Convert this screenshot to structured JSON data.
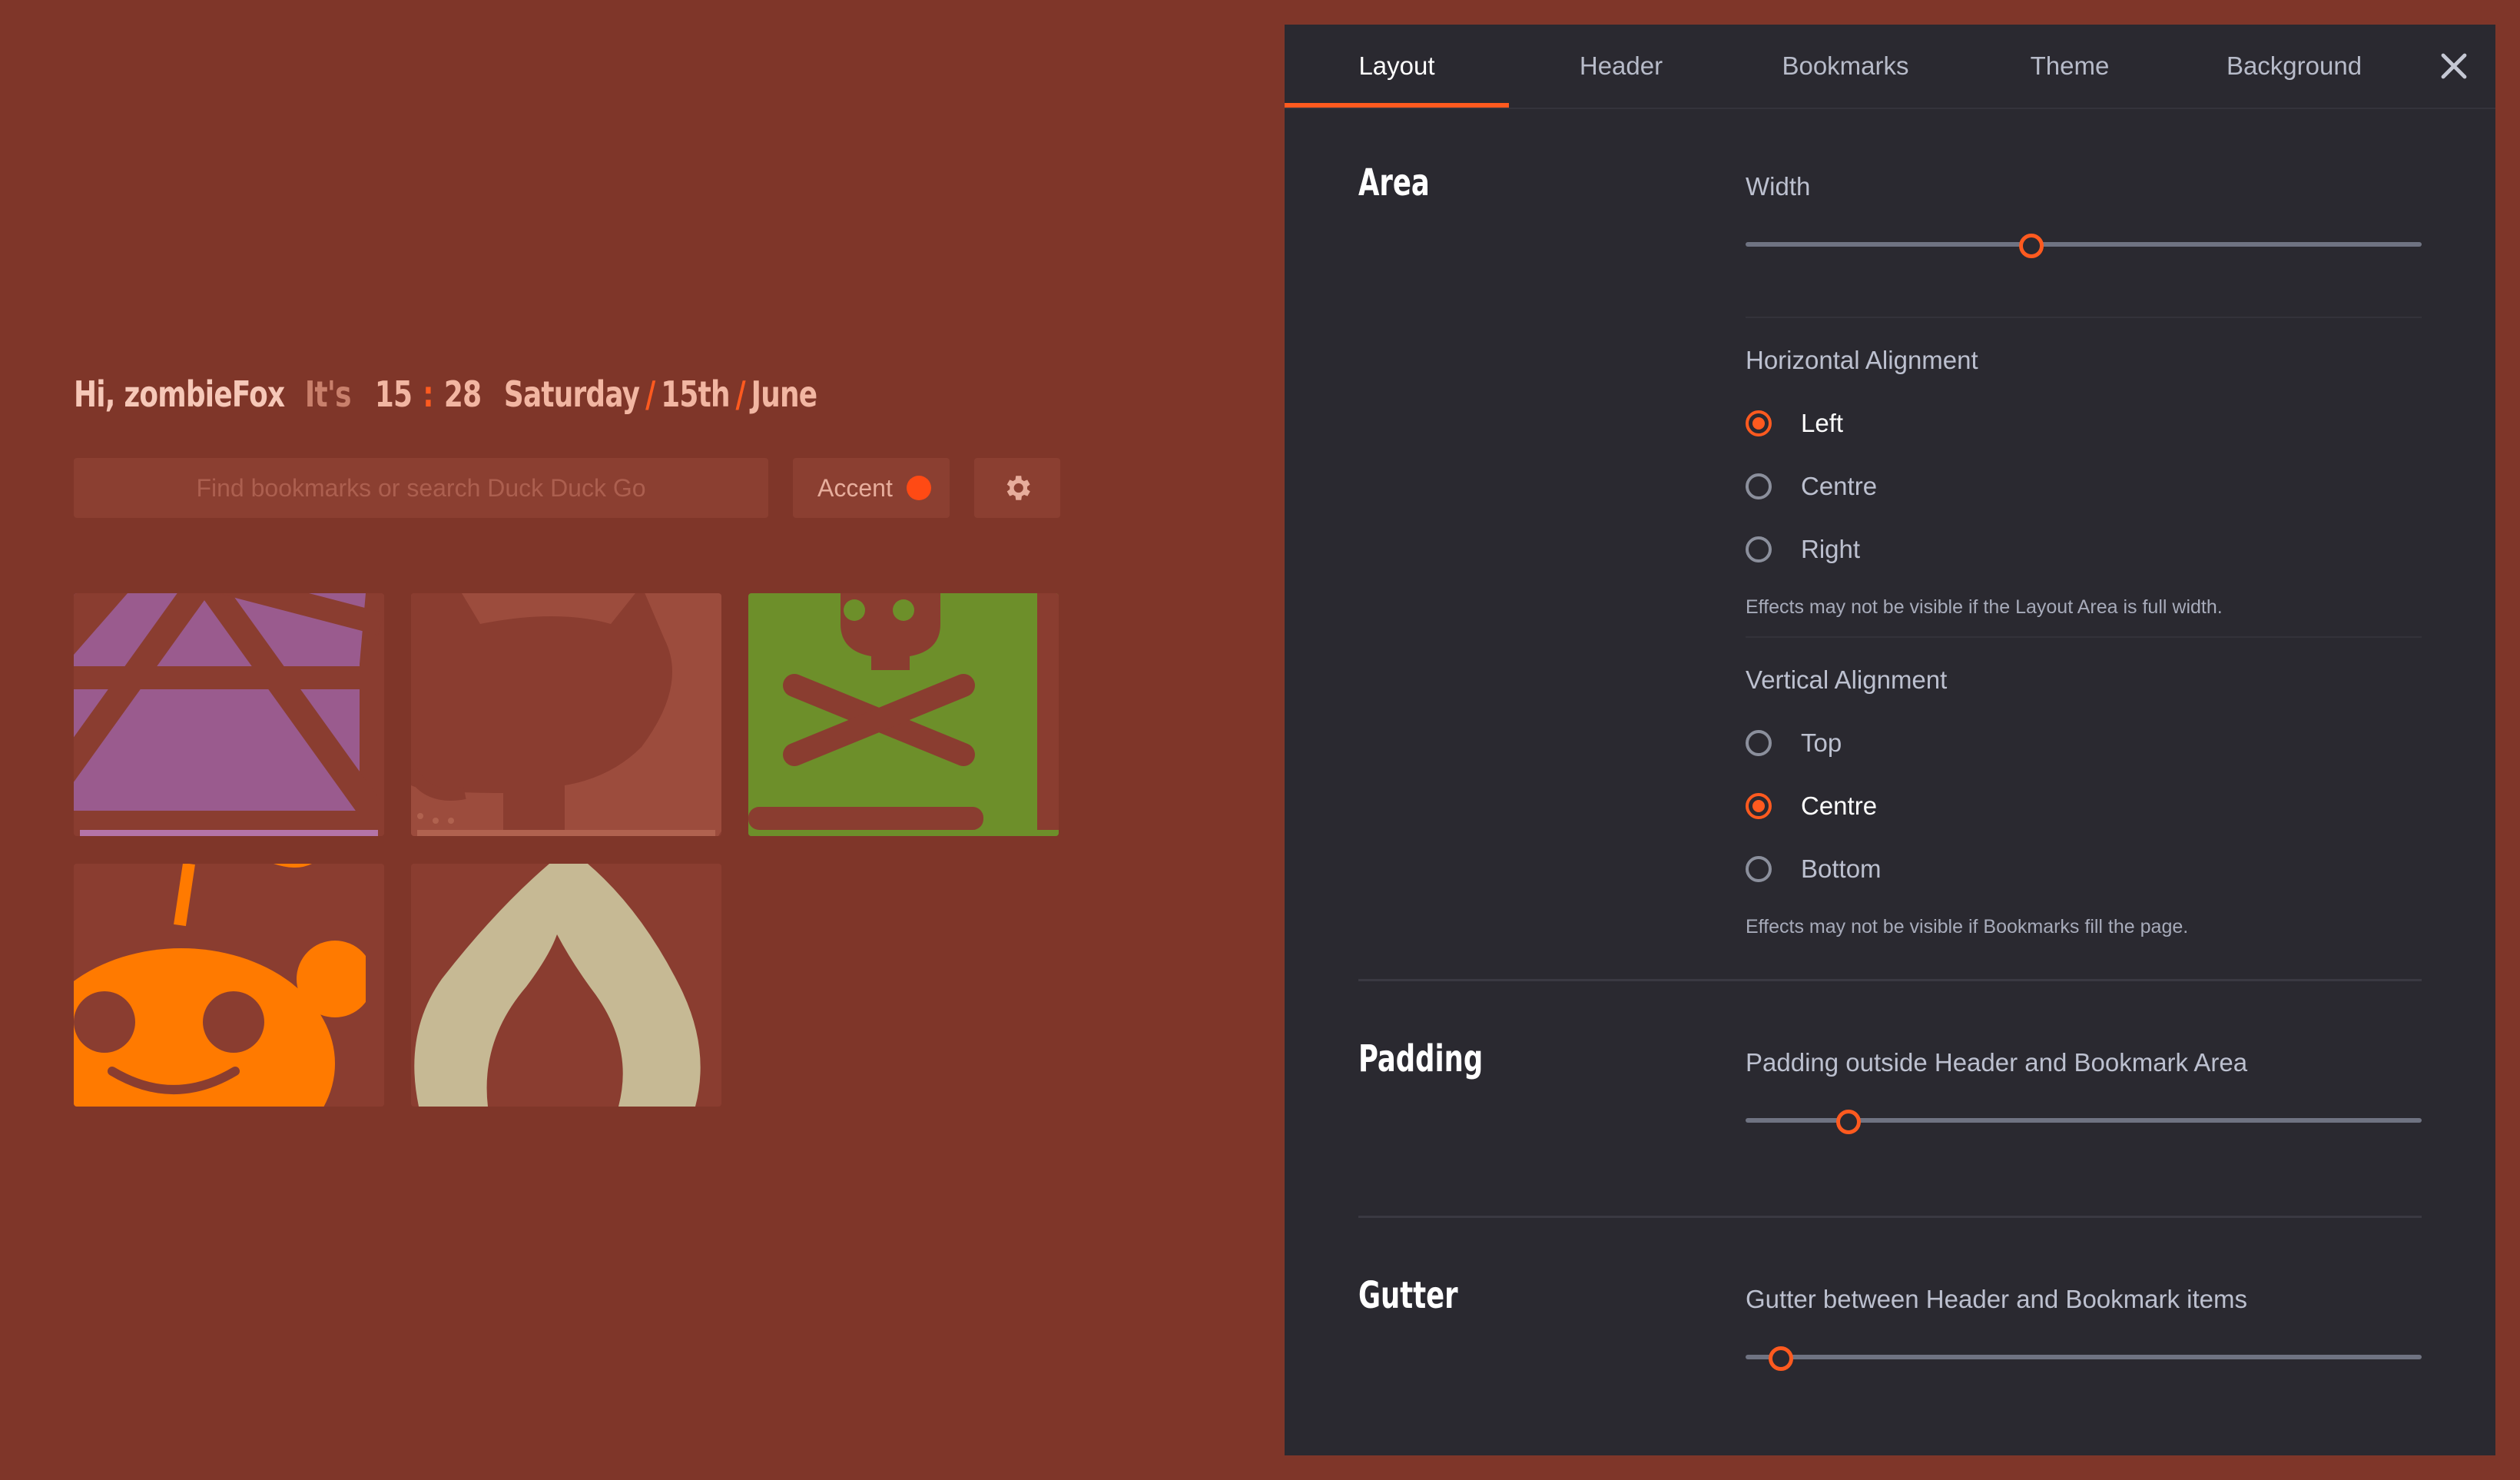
{
  "greeting": {
    "hi": "Hi, zombieFox",
    "its": "It's",
    "hour": "15",
    "colon": ":",
    "minute": "28",
    "day": "Saturday",
    "sep1": "/",
    "date": "15th",
    "sep2": "/",
    "month": "June"
  },
  "search": {
    "placeholder": "Find bookmarks or search Duck Duck Go"
  },
  "accent": {
    "label": "Accent",
    "color": "#ff4a14"
  },
  "gear": {
    "icon": "gear-icon"
  },
  "bookmarks": [
    {
      "icon": "d20-icon",
      "color": "#9a5b8e"
    },
    {
      "icon": "github-octocat-icon",
      "color": "#9c4c3d"
    },
    {
      "icon": "skull-crossbones-icon",
      "color": "#6d8f2a"
    },
    {
      "icon": "reddit-alien-icon",
      "color": "#ff7a00"
    },
    {
      "icon": "flame-icon",
      "color": "#c6b994"
    }
  ],
  "settings": {
    "tabs": [
      "Layout",
      "Header",
      "Bookmarks",
      "Theme",
      "Background"
    ],
    "active_tab": "Layout",
    "close_icon": "close-icon",
    "area": {
      "title": "Area",
      "width_label": "Width",
      "width_value": 0.42,
      "halign_label": "Horizontal Alignment",
      "halign_options": [
        "Left",
        "Centre",
        "Right"
      ],
      "halign_selected": "Left",
      "halign_hint": "Effects may not be visible if the Layout Area is full width.",
      "valign_label": "Vertical Alignment",
      "valign_options": [
        "Top",
        "Centre",
        "Bottom"
      ],
      "valign_selected": "Centre",
      "valign_hint": "Effects may not be visible if Bookmarks fill the page."
    },
    "padding": {
      "title": "Padding",
      "label": "Padding outside Header and Bookmark Area",
      "value": 0.15
    },
    "gutter": {
      "title": "Gutter",
      "label": "Gutter between Header and Bookmark items",
      "value": 0.05
    }
  }
}
